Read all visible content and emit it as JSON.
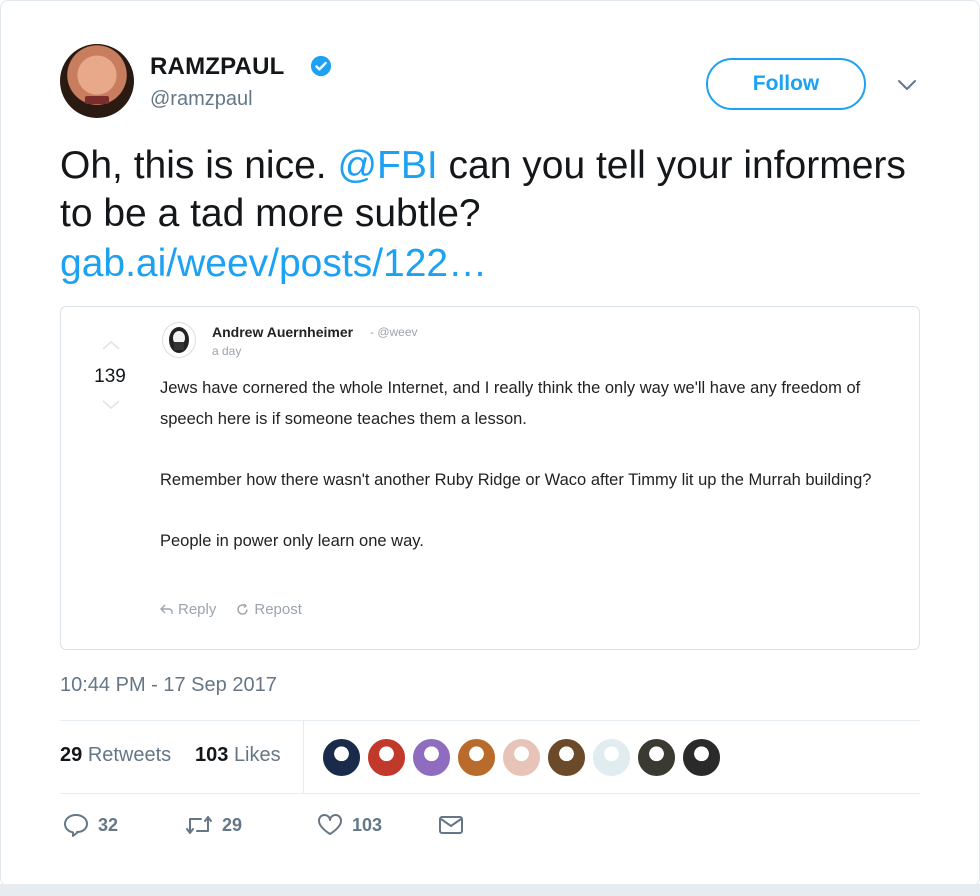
{
  "author": {
    "name": "RAMZPAUL",
    "handle": "@ramzpaul",
    "verified": true
  },
  "follow_label": "Follow",
  "tweet": {
    "text_before": "Oh, this is nice. ",
    "mention": "@FBI",
    "text_after": " can you tell your informers to be a tad more subtle?",
    "link": "gab.ai/weev/posts/122…"
  },
  "quoted": {
    "score": "139",
    "author_name": "Andrew Auernheimer",
    "author_handle": "- @weev",
    "time": "a day",
    "paragraphs": [
      "Jews have cornered the whole Internet, and I really think the only way we'll have any freedom of speech here is if someone teaches them a lesson.",
      "Remember how there wasn't another Ruby Ridge or Waco after Timmy lit up the Murrah building?",
      "People in power only learn one way."
    ],
    "reply_label": "Reply",
    "repost_label": "Repost"
  },
  "timestamp": "10:44 PM - 17 Sep 2017",
  "stats": {
    "retweets_count": "29",
    "retweets_label": "Retweets",
    "likes_count": "103",
    "likes_label": "Likes"
  },
  "liker_colors": [
    "#1a2a4a",
    "#c0392b",
    "#8e6cc0",
    "#b86b2a",
    "#e8c4b8",
    "#6b4a2a",
    "#e0ecf0",
    "#3a3a32",
    "#2a2a2a"
  ],
  "actions": {
    "replies": "32",
    "retweets": "29",
    "likes": "103"
  },
  "colors": {
    "accent": "#1da1f2",
    "secondary_text": "#657786"
  }
}
